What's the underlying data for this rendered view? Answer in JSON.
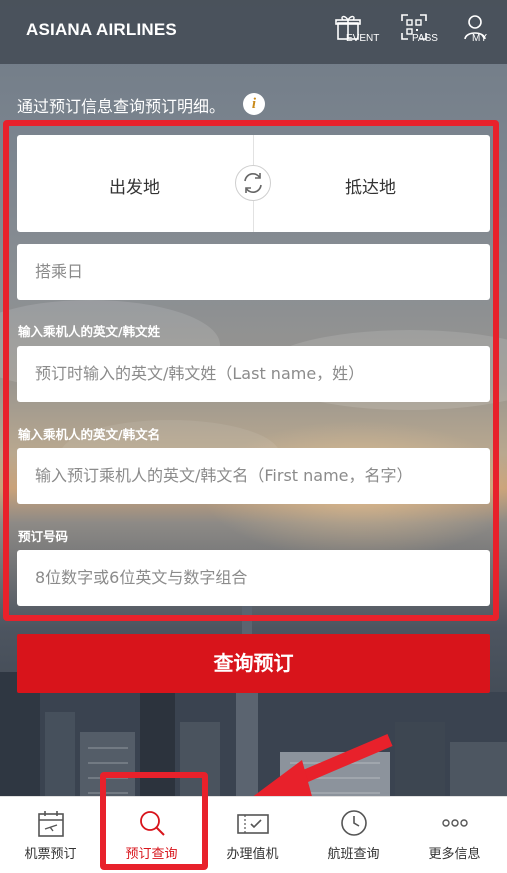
{
  "header": {
    "logo": "ASIANA AIRLINES",
    "buttons": [
      {
        "label": "EVENT",
        "icon": "gift-icon"
      },
      {
        "label": "PASS",
        "icon": "qr-code-icon"
      },
      {
        "label": "MY",
        "icon": "user-icon"
      }
    ]
  },
  "intro": {
    "text": "通过预订信息查询预订明细。",
    "info_icon": "i"
  },
  "route": {
    "departure": "出发地",
    "arrival": "抵达地",
    "swap_icon": "swap-icon"
  },
  "form": {
    "date_placeholder": "搭乘日",
    "last_name_label": "输入乘机人的英文/韩文姓",
    "last_name_placeholder": "预订时输入的英文/韩文姓（Last name，姓）",
    "first_name_label": "输入乘机人的英文/韩文名",
    "first_name_placeholder": "输入预订乘机人的英文/韩文名（First name，名字）",
    "booking_label": "预订号码",
    "booking_placeholder": "8位数字或6位英文与数字组合",
    "submit": "查询预订"
  },
  "bottom_nav": [
    {
      "label": "机票预订",
      "icon": "ticket-calendar-icon",
      "active": false
    },
    {
      "label": "预订查询",
      "icon": "search-icon",
      "active": true
    },
    {
      "label": "办理值机",
      "icon": "boarding-pass-icon",
      "active": false
    },
    {
      "label": "航班查询",
      "icon": "clock-icon",
      "active": false
    },
    {
      "label": "更多信息",
      "icon": "more-icon",
      "active": false
    }
  ],
  "colors": {
    "accent": "#d8141b",
    "highlight": "#e8212b"
  }
}
